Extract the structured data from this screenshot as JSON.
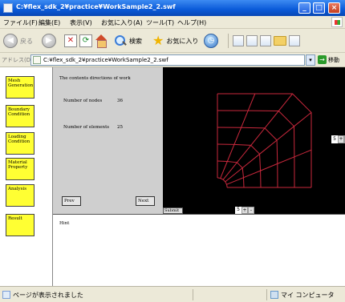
{
  "window": {
    "title": "C:¥flex_sdk_2¥practice¥WorkSample2_2.swf",
    "minimize_icon": "minimize-icon",
    "maximize_icon": "maximize-icon",
    "close_icon": "close-icon"
  },
  "menu": {
    "items": [
      "ファイル(F)",
      "編集(E)",
      "表示(V)",
      "お気に入り(A)",
      "ツール(T)",
      "ヘルプ(H)"
    ]
  },
  "toolbar": {
    "back_label": "戻る",
    "search_label": "検索",
    "favorites_label": "お気に入り"
  },
  "address": {
    "label": "アドレス(D)",
    "url": "C:¥flex_sdk_2¥practice¥WorkSample2_2.swf",
    "go_label": "移動"
  },
  "nav": {
    "buttons": [
      "Mesh Generation",
      "Boundary Condition",
      "Loading Condition",
      "Material Property",
      "Analysis",
      "Result"
    ]
  },
  "info": {
    "heading": "The contents directions of work",
    "nodes_label": "Number of nodes",
    "nodes_value": "36",
    "elements_label": "Number of elements",
    "elements_value": "25",
    "prev_label": "Prev",
    "next_label": "Next"
  },
  "mesh": {
    "stepper_value": "5",
    "bottom_stepper_value": "5",
    "submit_label": "Submit",
    "inc_label": "+",
    "dec_label": "-",
    "line_color": "#c8283c",
    "background": "#000000"
  },
  "hint": {
    "label": "Hint"
  },
  "status": {
    "text": "ページが表示されました",
    "zone": "マイ コンピュータ"
  }
}
